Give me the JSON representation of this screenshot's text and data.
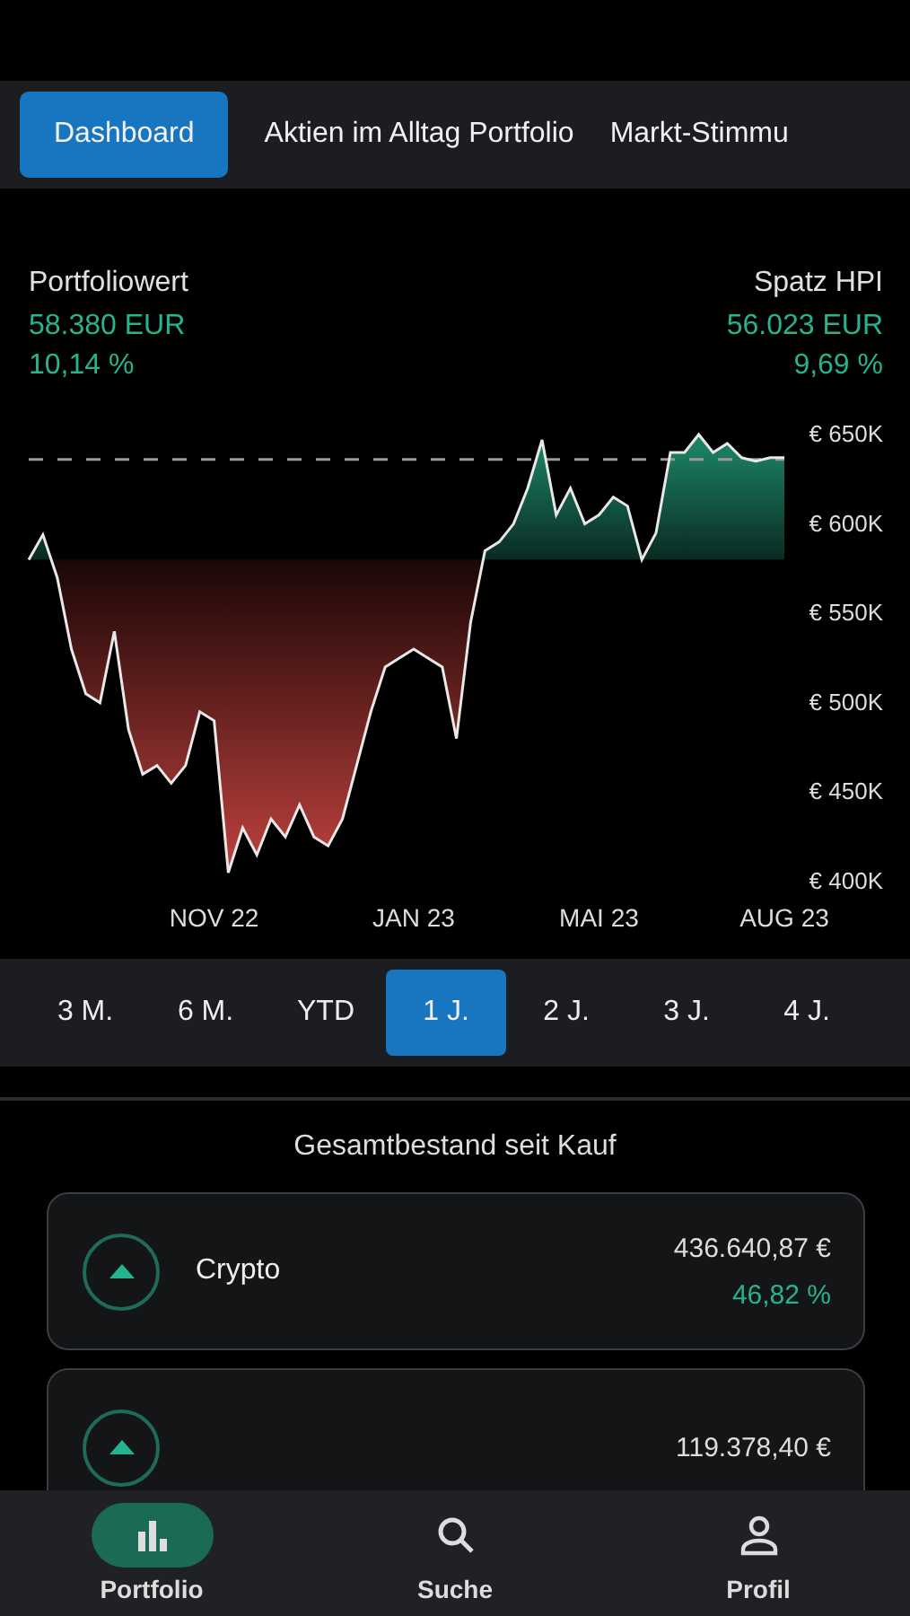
{
  "tabs": [
    {
      "label": "Dashboard",
      "selected": true
    },
    {
      "label": "Aktien im Alltag Portfolio",
      "selected": false
    },
    {
      "label": "Markt-Stimmu",
      "selected": false
    }
  ],
  "summary": {
    "left": {
      "label": "Portfoliowert",
      "value": "58.380 EUR",
      "change": "10,14 %"
    },
    "right": {
      "label": "Spatz HPI",
      "value": "56.023 EUR",
      "change": "9,69 %"
    }
  },
  "chart_data": {
    "type": "area",
    "categories": [
      null,
      null,
      null,
      null,
      null,
      null,
      null,
      null,
      null,
      null,
      null,
      null,
      null,
      "NOV 22",
      null,
      null,
      null,
      null,
      null,
      null,
      null,
      null,
      null,
      null,
      null,
      null,
      null,
      "JAN 23",
      null,
      null,
      null,
      null,
      null,
      null,
      null,
      null,
      null,
      null,
      null,
      null,
      "MAI 23",
      null,
      null,
      null,
      null,
      null,
      null,
      null,
      null,
      null,
      null,
      null,
      null,
      "AUG 23"
    ],
    "series": [
      {
        "color": "#e8e8e8",
        "values": [
          579,
          593,
          569,
          529,
          504,
          499,
          539,
          484,
          459,
          464,
          454,
          464,
          494,
          489,
          404,
          429,
          414,
          434,
          424,
          442,
          424,
          419,
          434,
          464,
          494,
          519,
          524,
          529,
          524,
          519,
          479,
          544,
          584,
          589,
          599,
          619,
          646,
          604,
          619,
          599,
          604,
          614,
          609,
          579,
          594,
          639,
          639,
          649,
          639,
          644,
          636,
          634,
          636,
          636
        ]
      },
      {
        "type": "line",
        "color": "#9a9a9a",
        "line_style": "dashed",
        "values": [
          635,
          635,
          635,
          635,
          635,
          635,
          635,
          635,
          635,
          635,
          635,
          635,
          635,
          635,
          635,
          635,
          635,
          635,
          635,
          635,
          635,
          635,
          635,
          635,
          635,
          635,
          635,
          635,
          635,
          635,
          635,
          635,
          635,
          635,
          635,
          635,
          635,
          635,
          635,
          635,
          635,
          635,
          635,
          635,
          635,
          635,
          635,
          635,
          635,
          635,
          635,
          635,
          635,
          635
        ]
      }
    ],
    "ylim": [
      400,
      650
    ],
    "yticks": [
      {
        "value": 650,
        "label": "€ 650K"
      },
      {
        "value": 600,
        "label": "€ 600K"
      },
      {
        "value": 550,
        "label": "€ 550K"
      },
      {
        "value": 500,
        "label": "€ 500K"
      },
      {
        "value": 450,
        "label": "€ 450K"
      },
      {
        "value": 400,
        "label": "€ 400K"
      }
    ]
  },
  "ranges": [
    {
      "label": "3 M.",
      "selected": false
    },
    {
      "label": "6 M.",
      "selected": false
    },
    {
      "label": "YTD",
      "selected": false
    },
    {
      "label": "1 J.",
      "selected": true
    },
    {
      "label": "2 J.",
      "selected": false
    },
    {
      "label": "3 J.",
      "selected": false
    },
    {
      "label": "4 J.",
      "selected": false
    }
  ],
  "holdings_title": "Gesamtbestand seit Kauf",
  "holdings": [
    {
      "name": "Crypto",
      "value": "436.640,87 €",
      "change": "46,82 %",
      "kind": "up"
    },
    {
      "value": "119.378,40 €",
      "kind": "up"
    }
  ],
  "nav": [
    {
      "label": "Portfolio",
      "kind": "chart",
      "selected": true
    },
    {
      "label": "Suche",
      "kind": "search",
      "selected": false
    },
    {
      "label": "Profil",
      "kind": "person",
      "selected": false
    }
  ]
}
